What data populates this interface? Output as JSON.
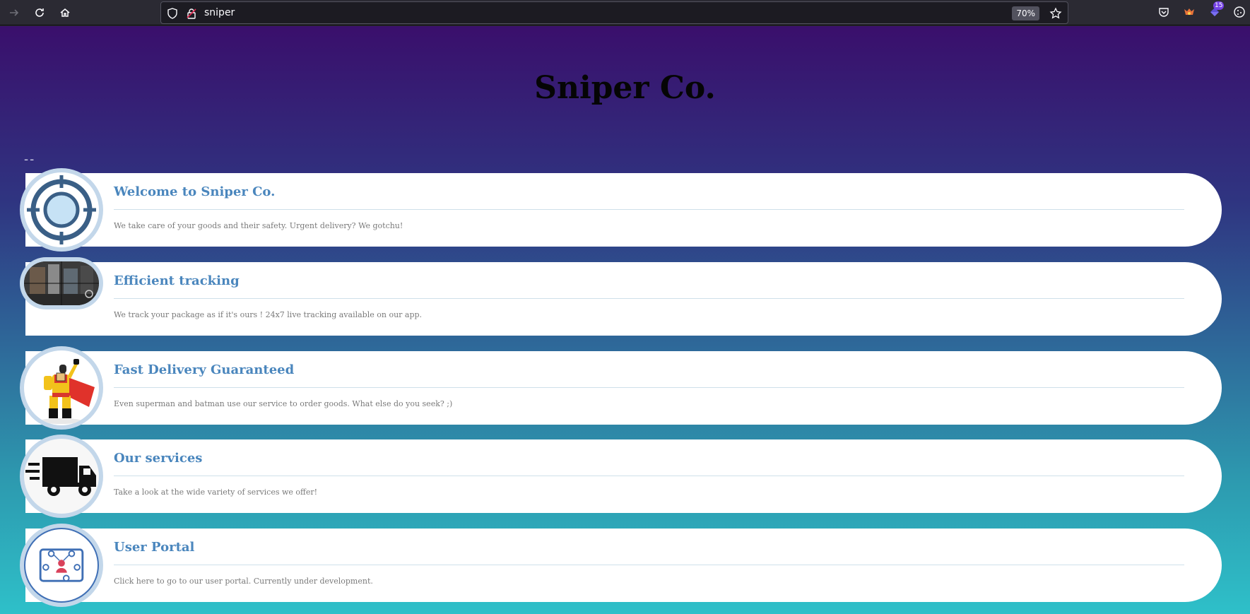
{
  "browser": {
    "url": "sniper",
    "zoom": "70%",
    "badge_count": "15"
  },
  "page": {
    "title": "Sniper Co.",
    "divider": "--"
  },
  "cards": [
    {
      "title": "Welcome to Sniper Co.",
      "text": "We take care of your goods and their safety. Urgent delivery? We gotchu!",
      "icon": "crosshair-icon"
    },
    {
      "title": "Efficient tracking",
      "text": "We track your package as if it's ours ! 24x7 live tracking available on our app.",
      "icon": "scope-view-image"
    },
    {
      "title": "Fast Delivery Guaranteed",
      "text": "Even superman and batman use our service to order goods. What else do you seek? ;)",
      "icon": "superhero-courier-image"
    },
    {
      "title": "Our services",
      "text": "Take a look at the wide variety of services we offer!",
      "icon": "delivery-truck-icon"
    },
    {
      "title": "User Portal",
      "text": "Click here to go to our user portal. Currently under development.",
      "icon": "user-network-icon"
    }
  ],
  "colors": {
    "card_title": "#4a86bd",
    "gradient_top": "#3a0f6c",
    "gradient_bottom": "#2ec0c9"
  }
}
